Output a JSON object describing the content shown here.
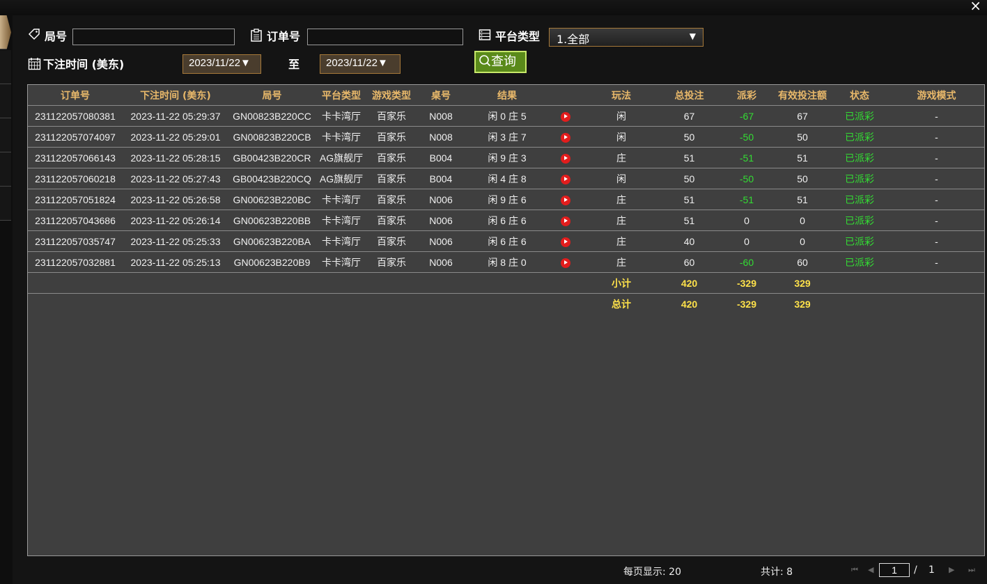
{
  "window": {
    "close": "×"
  },
  "filters": {
    "round_label": "局号",
    "round_value": "",
    "order_label": "订单号",
    "order_value": "",
    "platform_label": "平台类型",
    "platform_selected": "1.全部",
    "bettime_label": "下注时间 (美东)",
    "date_from": "2023/11/22▼",
    "to_label": "至",
    "date_to": "2023/11/22▼",
    "query_label": "查询"
  },
  "table": {
    "headers": [
      "订单号",
      "下注时间 (美东)",
      "局号",
      "平台类型",
      "游戏类型",
      "桌号",
      "结果",
      "",
      "玩法",
      "总投注",
      "派彩",
      "有效投注额",
      "状态",
      "游戏模式"
    ],
    "rows": [
      {
        "order": "231122057080381",
        "time": "2023-11-22 05:29:37",
        "round": "GN00823B220CC",
        "platform": "卡卡湾厅",
        "game": "百家乐",
        "table": "N008",
        "result": "闲 0 庄 5",
        "play": "闲",
        "bet": "67",
        "payout": "-67",
        "valid": "67",
        "status": "已派彩",
        "mode": "-"
      },
      {
        "order": "231122057074097",
        "time": "2023-11-22 05:29:01",
        "round": "GN00823B220CB",
        "platform": "卡卡湾厅",
        "game": "百家乐",
        "table": "N008",
        "result": "闲 3 庄 7",
        "play": "闲",
        "bet": "50",
        "payout": "-50",
        "valid": "50",
        "status": "已派彩",
        "mode": "-"
      },
      {
        "order": "231122057066143",
        "time": "2023-11-22 05:28:15",
        "round": "GB00423B220CR",
        "platform": "AG旗舰厅",
        "game": "百家乐",
        "table": "B004",
        "result": "闲 9 庄 3",
        "play": "庄",
        "bet": "51",
        "payout": "-51",
        "valid": "51",
        "status": "已派彩",
        "mode": "-"
      },
      {
        "order": "231122057060218",
        "time": "2023-11-22 05:27:43",
        "round": "GB00423B220CQ",
        "platform": "AG旗舰厅",
        "game": "百家乐",
        "table": "B004",
        "result": "闲 4 庄 8",
        "play": "闲",
        "bet": "50",
        "payout": "-50",
        "valid": "50",
        "status": "已派彩",
        "mode": "-"
      },
      {
        "order": "231122057051824",
        "time": "2023-11-22 05:26:58",
        "round": "GN00623B220BC",
        "platform": "卡卡湾厅",
        "game": "百家乐",
        "table": "N006",
        "result": "闲 9 庄 6",
        "play": "庄",
        "bet": "51",
        "payout": "-51",
        "valid": "51",
        "status": "已派彩",
        "mode": "-"
      },
      {
        "order": "231122057043686",
        "time": "2023-11-22 05:26:14",
        "round": "GN00623B220BB",
        "platform": "卡卡湾厅",
        "game": "百家乐",
        "table": "N006",
        "result": "闲 6 庄 6",
        "play": "庄",
        "bet": "51",
        "payout": "0",
        "valid": "0",
        "status": "已派彩",
        "mode": "-"
      },
      {
        "order": "231122057035747",
        "time": "2023-11-22 05:25:33",
        "round": "GN00623B220BA",
        "platform": "卡卡湾厅",
        "game": "百家乐",
        "table": "N006",
        "result": "闲 6 庄 6",
        "play": "庄",
        "bet": "40",
        "payout": "0",
        "valid": "0",
        "status": "已派彩",
        "mode": "-"
      },
      {
        "order": "231122057032881",
        "time": "2023-11-22 05:25:13",
        "round": "GN00623B220B9",
        "platform": "卡卡湾厅",
        "game": "百家乐",
        "table": "N006",
        "result": "闲 8 庄 0",
        "play": "庄",
        "bet": "60",
        "payout": "-60",
        "valid": "60",
        "status": "已派彩",
        "mode": "-"
      }
    ],
    "subtotal": {
      "label": "小计",
      "bet": "420",
      "payout": "-329",
      "valid": "329"
    },
    "total": {
      "label": "总计",
      "bet": "420",
      "payout": "-329",
      "valid": "329"
    }
  },
  "footer": {
    "per_page": "每页显示: 20",
    "total_count": "共计: 8",
    "page_current": "1",
    "page_sep": "/",
    "page_total": "1",
    "first_icon": "⏮",
    "prev_icon": "◀",
    "next_icon": "▶",
    "last_icon": "⏭"
  },
  "colors": {
    "header_text": "#e8b86a",
    "positive_green": "#33dd33",
    "summary_yellow": "#ffe24a",
    "query_green": "#5a8a1a"
  },
  "icons": {
    "round": "tag-icon",
    "order": "clipboard-icon",
    "platform": "server-icon",
    "date": "calendar-icon",
    "query": "search-icon",
    "replay": "play-icon"
  }
}
